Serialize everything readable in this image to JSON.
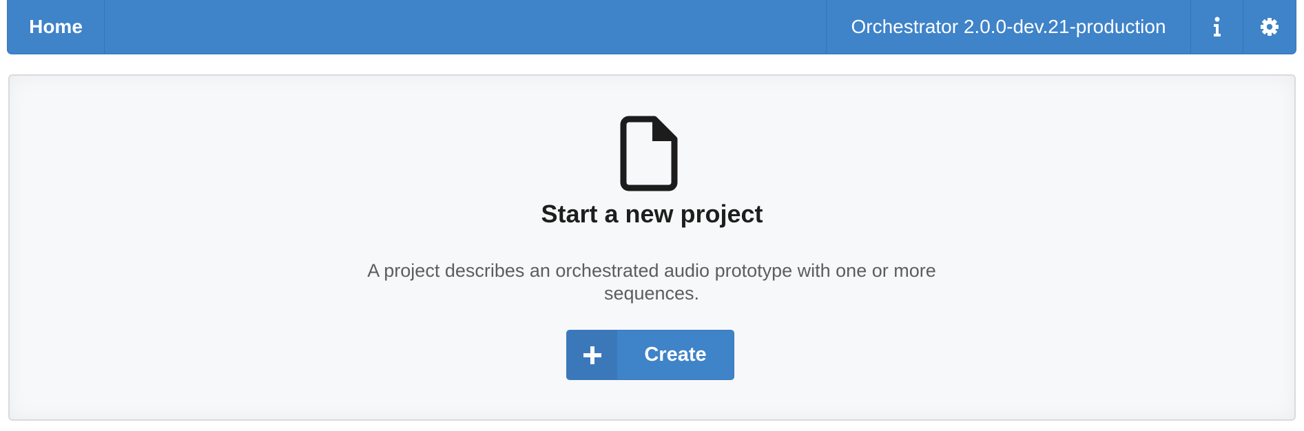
{
  "navbar": {
    "home_label": "Home",
    "version_text": "Orchestrator 2.0.0-dev.21-production",
    "info_icon": "info-icon",
    "settings_icon": "gear-icon",
    "color": "#3f83c9"
  },
  "main": {
    "icon": "document-icon",
    "title": "Start a new project",
    "description": "A project describes an orchestrated audio prototype with one or more sequences.",
    "create_button": {
      "icon": "plus-icon",
      "label": "Create"
    }
  }
}
